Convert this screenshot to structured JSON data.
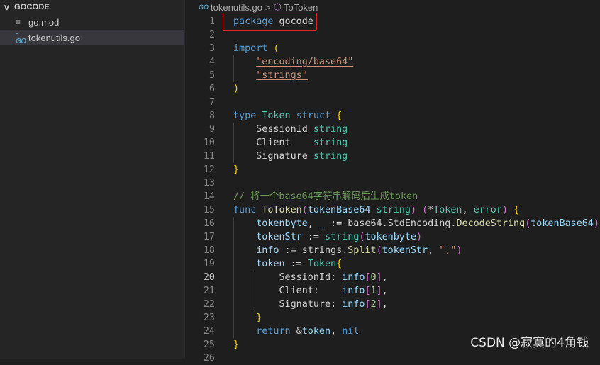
{
  "explorer": {
    "folder": "GOCODE",
    "files": [
      {
        "name": "go.mod",
        "icon": "go-mod-file-icon",
        "active": false
      },
      {
        "name": "tokenutils.go",
        "icon": "go-file-icon",
        "active": true
      }
    ]
  },
  "breadcrumb": {
    "go_icon_text": "GO",
    "file": "tokenutils.go",
    "separator": ">",
    "symbol": "ToToken"
  },
  "editor": {
    "active_line": 20,
    "lines": [
      {
        "n": "1",
        "t": "package gocode"
      },
      {
        "n": "2",
        "t": ""
      },
      {
        "n": "3",
        "t": "import ("
      },
      {
        "n": "4",
        "t": "    \"encoding/base64\""
      },
      {
        "n": "5",
        "t": "    \"strings\""
      },
      {
        "n": "6",
        "t": ")"
      },
      {
        "n": "7",
        "t": ""
      },
      {
        "n": "8",
        "t": "type Token struct {"
      },
      {
        "n": "9",
        "t": "    SessionId string"
      },
      {
        "n": "10",
        "t": "    Client    string"
      },
      {
        "n": "11",
        "t": "    Signature string"
      },
      {
        "n": "12",
        "t": "}"
      },
      {
        "n": "13",
        "t": ""
      },
      {
        "n": "14",
        "t": "// 将一个base64字符串解码后生成token"
      },
      {
        "n": "15",
        "t": "func ToToken(tokenBase64 string) (*Token, error) {"
      },
      {
        "n": "16",
        "t": "    tokenbyte, _ := base64.StdEncoding.DecodeString(tokenBase64)"
      },
      {
        "n": "17",
        "t": "    tokenStr := string(tokenbyte)"
      },
      {
        "n": "18",
        "t": "    info := strings.Split(tokenStr, \",\")"
      },
      {
        "n": "19",
        "t": "    token := Token{"
      },
      {
        "n": "20",
        "t": "        SessionId: info[0],"
      },
      {
        "n": "21",
        "t": "        Client:    info[1],"
      },
      {
        "n": "22",
        "t": "        Signature: info[2],"
      },
      {
        "n": "23",
        "t": "    }"
      },
      {
        "n": "24",
        "t": "    return &token, nil"
      },
      {
        "n": "25",
        "t": "}"
      },
      {
        "n": "26",
        "t": ""
      }
    ]
  },
  "watermark": "CSDN @寂寞的4角钱",
  "colors": {
    "keyword": "#569cd6",
    "type": "#4ec9b0",
    "function": "#dcdcaa",
    "variable": "#9cdcfe",
    "string": "#ce9178",
    "comment": "#6a9955",
    "number": "#b5cea8",
    "highlight_box": "#e02424"
  }
}
